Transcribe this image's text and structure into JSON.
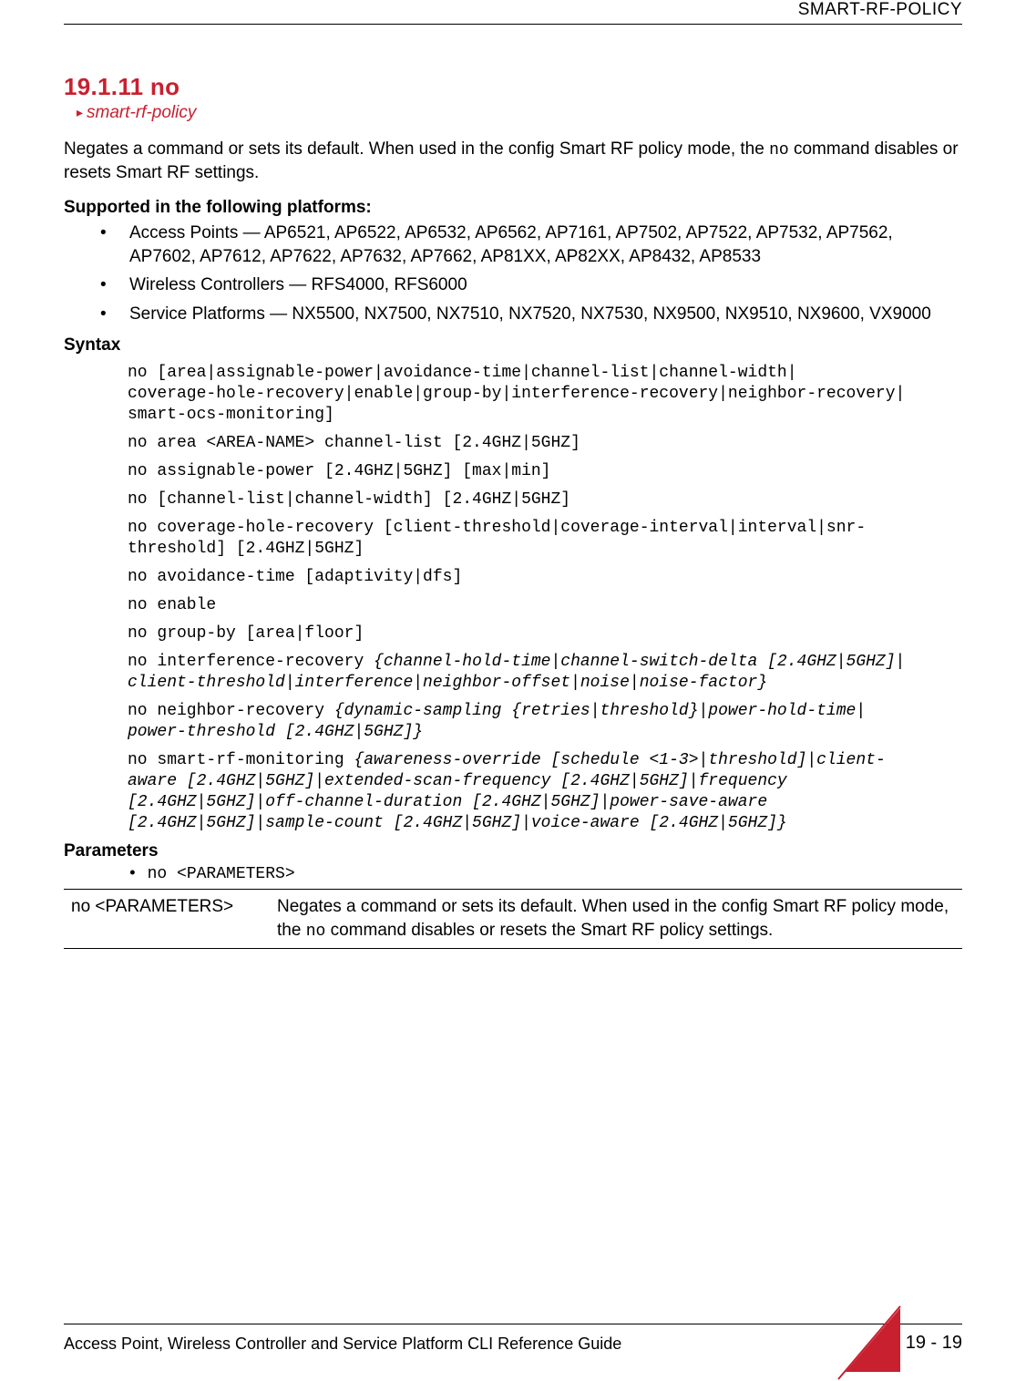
{
  "header": {
    "running": "SMART-RF-POLICY"
  },
  "title": "19.1.11 no",
  "breadcrumb": "smart-rf-policy",
  "intro_pre": "Negates a command or sets its default. When used in the config Smart RF policy mode, the ",
  "intro_code": "no",
  "intro_post": " command disables or resets Smart RF settings.",
  "platforms_heading": "Supported in the following platforms:",
  "platforms": [
    "Access Points — AP6521, AP6522, AP6532, AP6562, AP7161, AP7502, AP7522, AP7532, AP7562, AP7602, AP7612, AP7622, AP7632, AP7662, AP81XX, AP82XX, AP8432, AP8533",
    "Wireless Controllers — RFS4000, RFS6000",
    "Service Platforms — NX5500, NX7500, NX7510, NX7520, NX7530, NX9500, NX9510, NX9600, VX9000"
  ],
  "syntax_heading": "Syntax",
  "syntax": {
    "l1": "no [area|assignable-power|avoidance-time|channel-list|channel-width|\ncoverage-hole-recovery|enable|group-by|interference-recovery|neighbor-recovery|\nsmart-ocs-monitoring]",
    "l2": "no area <AREA-NAME> channel-list [2.4GHZ|5GHZ]",
    "l3": "no assignable-power [2.4GHZ|5GHZ] [max|min]",
    "l4": "no [channel-list|channel-width] [2.4GHZ|5GHZ]",
    "l5": "no coverage-hole-recovery [client-threshold|coverage-interval|interval|snr-\nthreshold] [2.4GHZ|5GHZ]",
    "l6": "no avoidance-time [adaptivity|dfs]",
    "l7": "no enable",
    "l8": "no group-by [area|floor]",
    "l9a": "no interference-recovery ",
    "l9b": "{channel-hold-time|channel-switch-delta [2.4GHZ|5GHZ]|\nclient-threshold|interference|neighbor-offset|noise|noise-factor}",
    "l10a": "no neighbor-recovery ",
    "l10b": "{dynamic-sampling {retries|threshold}|power-hold-time|\npower-threshold [2.4GHZ|5GHZ]}",
    "l11a": "no smart-rf-monitoring ",
    "l11b": "{awareness-override [schedule <1-3>|threshold]|client-\naware [2.4GHZ|5GHZ]|extended-scan-frequency [2.4GHZ|5GHZ]|frequency \n[2.4GHZ|5GHZ]|off-channel-duration [2.4GHZ|5GHZ]|power-save-aware \n[2.4GHZ|5GHZ]|sample-count [2.4GHZ|5GHZ]|voice-aware [2.4GHZ|5GHZ]}"
  },
  "parameters_heading": "Parameters",
  "param_bullet": "no <PARAMETERS>",
  "param_table": {
    "c1": "no <PARAMETERS>",
    "c2_pre": "Negates a command or sets its default. When used in the config Smart RF policy mode, the ",
    "c2_code": "no",
    "c2_post": " command disables or resets the Smart RF policy settings."
  },
  "footer": {
    "title": "Access Point, Wireless Controller and Service Platform CLI Reference Guide",
    "page": "19 - 19"
  }
}
